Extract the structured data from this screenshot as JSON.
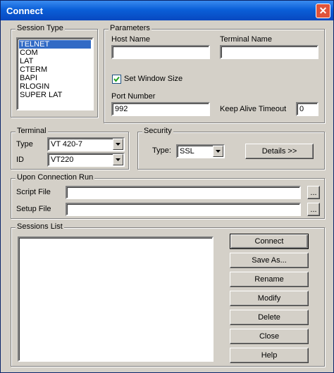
{
  "window": {
    "title": "Connect",
    "close_glyph": "✕"
  },
  "session_type": {
    "legend": "Session Type",
    "items": [
      "TELNET",
      "COM",
      "LAT",
      "CTERM",
      "BAPI",
      "RLOGIN",
      "SUPER LAT"
    ],
    "selected": "TELNET"
  },
  "parameters": {
    "legend": "Parameters",
    "host_name_label": "Host Name",
    "host_name_value": "",
    "terminal_name_label": "Terminal Name",
    "terminal_name_value": "",
    "set_window_size_label": "Set Window Size",
    "set_window_size_checked": true,
    "port_number_label": "Port Number",
    "port_number_value": "992",
    "keep_alive_label": "Keep Alive Timeout",
    "keep_alive_value": "0"
  },
  "terminal": {
    "legend": "Terminal",
    "type_label": "Type",
    "type_value": "VT 420-7",
    "id_label": "ID",
    "id_value": "VT220"
  },
  "security": {
    "legend": "Security",
    "type_label": "Type:",
    "type_value": "SSL",
    "details_label": "Details >>"
  },
  "upon_connection": {
    "legend": "Upon Connection Run",
    "script_file_label": "Script File",
    "script_file_value": "",
    "setup_file_label": "Setup File",
    "setup_file_value": "",
    "browse_label": "..."
  },
  "sessions_list": {
    "legend": "Sessions List",
    "items": []
  },
  "buttons": {
    "connect": "Connect",
    "save_as": "Save As...",
    "rename": "Rename",
    "modify": "Modify",
    "delete": "Delete",
    "close": "Close",
    "help": "Help"
  }
}
